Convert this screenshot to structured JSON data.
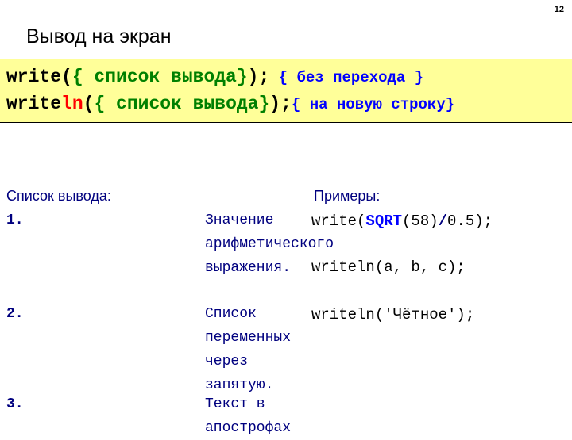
{
  "page_number": "12",
  "title": "Вывод на экран",
  "syntax": {
    "line1": {
      "kw": "write(",
      "args": "{ список вывода}",
      "end": ");",
      "comment": " { без перехода }"
    },
    "line2": {
      "kw": "write",
      "kw_red": "ln",
      "open": "(",
      "args": "{ список вывода}",
      "end": ");",
      "comment": "{ на новую строку}"
    }
  },
  "list_label": "Список вывода:",
  "examples_label": "Примеры:",
  "items": [
    {
      "num": "1.",
      "desc": "Значение арифметического выражения."
    },
    {
      "num": "2.",
      "desc": "Список переменных через запятую."
    },
    {
      "num": "3.",
      "desc": "Текст в апострофах"
    }
  ],
  "examples": {
    "ex1": {
      "pre": "write(",
      "kw": "SQRT",
      "mid": "(58)",
      "op": "/",
      "post": "0.5);"
    },
    "ex2": "writeln(a, b, c);",
    "ex3": "writeln('Чётное');"
  }
}
